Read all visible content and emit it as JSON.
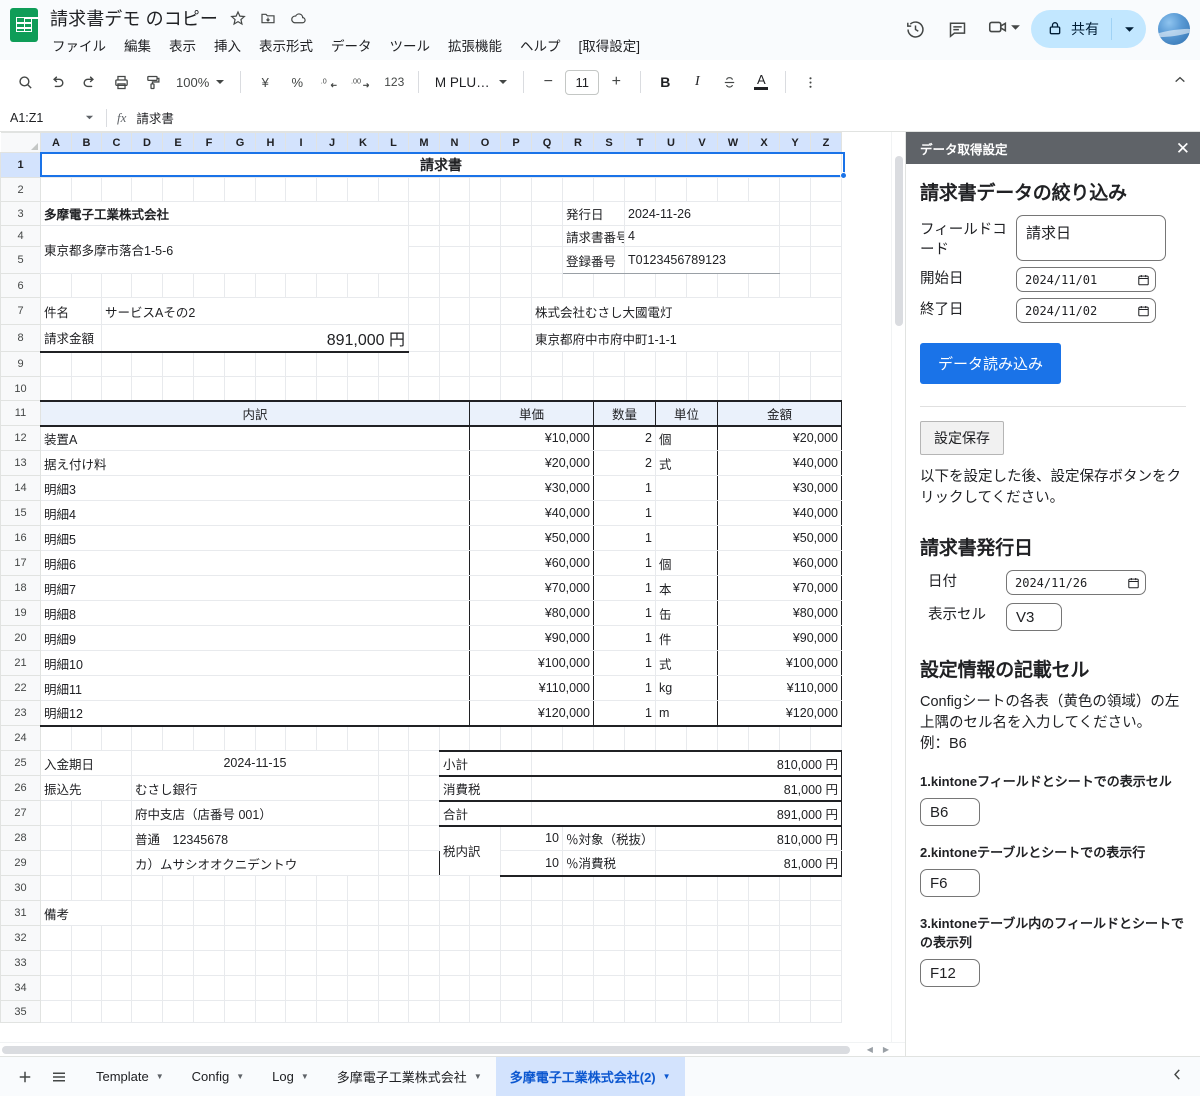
{
  "app": {
    "doc_title": "請求書デモ のコピー",
    "menus": [
      "ファイル",
      "編集",
      "表示",
      "挿入",
      "表示形式",
      "データ",
      "ツール",
      "拡張機能",
      "ヘルプ",
      "[取得設定]"
    ],
    "title_icons": [
      "star-icon",
      "move-to-folder-icon",
      "cloud-saved-icon"
    ],
    "top_right": {
      "history_icon": "version-history-icon",
      "comment_icon": "comment-icon",
      "meet_icon": "meet-video-icon",
      "share_label": "共有",
      "share_lock_icon": "lock-icon",
      "avatar": "user-avatar"
    }
  },
  "toolbar": {
    "search_icon": "search-icon",
    "undo_icon": "undo-icon",
    "redo_icon": "redo-icon",
    "print_icon": "print-icon",
    "paint_icon": "paint-format-icon",
    "zoom_value": "100%",
    "currency_icon": "¥",
    "percent_icon": "%",
    "dec_decimal_icon": ".0",
    "inc_decimal_icon": ".00",
    "number_format_label": "123",
    "font_name": "M PLU…",
    "font_minus": "−",
    "font_size": "11",
    "font_plus": "+",
    "bold_label": "B",
    "italic_label": "I",
    "strike_label": "S",
    "text_color_label": "A",
    "more_icon": "more-vertical-icon",
    "collapse_icon": "collapse-toolbar-icon"
  },
  "formula_bar": {
    "name_box": "A1:Z1",
    "fx_label": "fx",
    "content": "請求書"
  },
  "grid": {
    "columns": [
      "A",
      "B",
      "C",
      "D",
      "E",
      "F",
      "G",
      "H",
      "I",
      "J",
      "K",
      "L",
      "M",
      "N",
      "O",
      "P",
      "Q",
      "R",
      "S",
      "T",
      "U",
      "V",
      "W",
      "X",
      "Y",
      "Z"
    ],
    "selected_range_label": "A1:Z1",
    "rows": [
      1,
      2,
      3,
      4,
      5,
      6,
      7,
      8,
      9,
      10,
      11,
      12,
      13,
      14,
      15,
      16,
      17,
      18,
      19,
      20,
      21,
      22,
      23,
      24,
      25,
      26,
      27,
      28,
      29,
      30,
      31,
      32,
      33,
      34,
      35
    ],
    "invoice": {
      "title": "請求書",
      "issuer_name": "多摩電子工業株式会社",
      "issuer_address": "東京都多摩市落合1-5-6",
      "meta": [
        {
          "label": "発行日",
          "value": "2024-11-26"
        },
        {
          "label": "請求書番号",
          "value": "4"
        },
        {
          "label": "登録番号",
          "value": "T0123456789123"
        }
      ],
      "client_name": "株式会社むさし大國電灯",
      "client_address": "東京都府中市府中町1-1-1",
      "subject_label": "件名",
      "subject_value": "サービスAその2",
      "amount_label": "請求金額",
      "amount_value": "891,000 円",
      "table_headers": [
        "内訳",
        "単価",
        "数量",
        "単位",
        "金額"
      ],
      "items": [
        {
          "name": "装置A",
          "unit_price": "¥10,000",
          "qty": "2",
          "unit": "個",
          "amount": "¥20,000"
        },
        {
          "name": "据え付け料",
          "unit_price": "¥20,000",
          "qty": "2",
          "unit": "式",
          "amount": "¥40,000"
        },
        {
          "name": "明細3",
          "unit_price": "¥30,000",
          "qty": "1",
          "unit": "",
          "amount": "¥30,000"
        },
        {
          "name": "明細4",
          "unit_price": "¥40,000",
          "qty": "1",
          "unit": "",
          "amount": "¥40,000"
        },
        {
          "name": "明細5",
          "unit_price": "¥50,000",
          "qty": "1",
          "unit": "",
          "amount": "¥50,000"
        },
        {
          "name": "明細6",
          "unit_price": "¥60,000",
          "qty": "1",
          "unit": "個",
          "amount": "¥60,000"
        },
        {
          "name": "明細7",
          "unit_price": "¥70,000",
          "qty": "1",
          "unit": "本",
          "amount": "¥70,000"
        },
        {
          "name": "明細8",
          "unit_price": "¥80,000",
          "qty": "1",
          "unit": "缶",
          "amount": "¥80,000"
        },
        {
          "name": "明細9",
          "unit_price": "¥90,000",
          "qty": "1",
          "unit": "件",
          "amount": "¥90,000"
        },
        {
          "name": "明細10",
          "unit_price": "¥100,000",
          "qty": "1",
          "unit": "式",
          "amount": "¥100,000"
        },
        {
          "name": "明細11",
          "unit_price": "¥110,000",
          "qty": "1",
          "unit": "kg",
          "amount": "¥110,000"
        },
        {
          "name": "明細12",
          "unit_price": "¥120,000",
          "qty": "1",
          "unit": "m",
          "amount": "¥120,000"
        }
      ],
      "due_label": "入金期日",
      "due_value": "2024-11-15",
      "bank_label": "振込先",
      "bank_lines": [
        "むさし銀行",
        "府中支店（店番号 001）",
        "普通　12345678",
        "カ）ムサシオオクニデントウ"
      ],
      "remarks_label": "備考",
      "totals": [
        {
          "label": "小計",
          "value": "810,000 円"
        },
        {
          "label": "消費税",
          "value": "81,000 円"
        },
        {
          "label": "合計",
          "value": "891,000 円"
        }
      ],
      "tax_breakdown_label": "税内訳",
      "tax_rows": [
        {
          "rate": "10",
          "desc": "％対象（税抜）",
          "value": "810,000 円"
        },
        {
          "rate": "10",
          "desc": "％消費税",
          "value": "81,000 円"
        }
      ]
    }
  },
  "sidebar": {
    "header_title": "データ取得設定",
    "close_icon": "close-icon",
    "filter_section": {
      "heading": "請求書データの絞り込み",
      "field_code_label": "フィールドコード",
      "field_code_value": "請求日",
      "start_label": "開始日",
      "start_value": "2024/11/01",
      "end_label": "終了日",
      "end_value": "2024/11/02",
      "load_button": "データ読み込み"
    },
    "save_button": "設定保存",
    "save_note": "以下を設定した後、設定保存ボタンをクリックしてください。",
    "issue_date_section": {
      "heading": "請求書発行日",
      "date_label": "日付",
      "date_value": "2024/11/26",
      "cell_label": "表示セル",
      "cell_value": "V3"
    },
    "config_section": {
      "heading": "設定情報の記載セル",
      "description": "Configシートの各表（黄色の領域）の左上隅のセル名を入力してください。",
      "example": "例：B6",
      "items": [
        {
          "label": "1.kintoneフィールドとシートでの表示セル",
          "value": "B6"
        },
        {
          "label": "2.kintoneテーブルとシートでの表示行",
          "value": "F6"
        },
        {
          "label": "3.kintoneテーブル内のフィールドとシートでの表示列",
          "value": "F12"
        }
      ]
    }
  },
  "bottom": {
    "add_sheet_icon": "add-sheet-icon",
    "all_sheets_icon": "all-sheets-icon",
    "tabs": [
      {
        "label": "Template",
        "active": false
      },
      {
        "label": "Config",
        "active": false
      },
      {
        "label": "Log",
        "active": false
      },
      {
        "label": "多摩電子工業株式会社",
        "active": false
      },
      {
        "label": "多摩電子工業株式会社(2)",
        "active": true
      }
    ],
    "collapse_icon": "chevron-left-icon"
  },
  "colors": {
    "sheets_green": "#0f9d58",
    "accent_blue": "#1a73e8",
    "share_bg": "#c2e7ff",
    "active_tab_bg": "#d3e3fd",
    "sidebar_header_bg": "#5f6368",
    "header_fill": "#eaf1fb"
  }
}
